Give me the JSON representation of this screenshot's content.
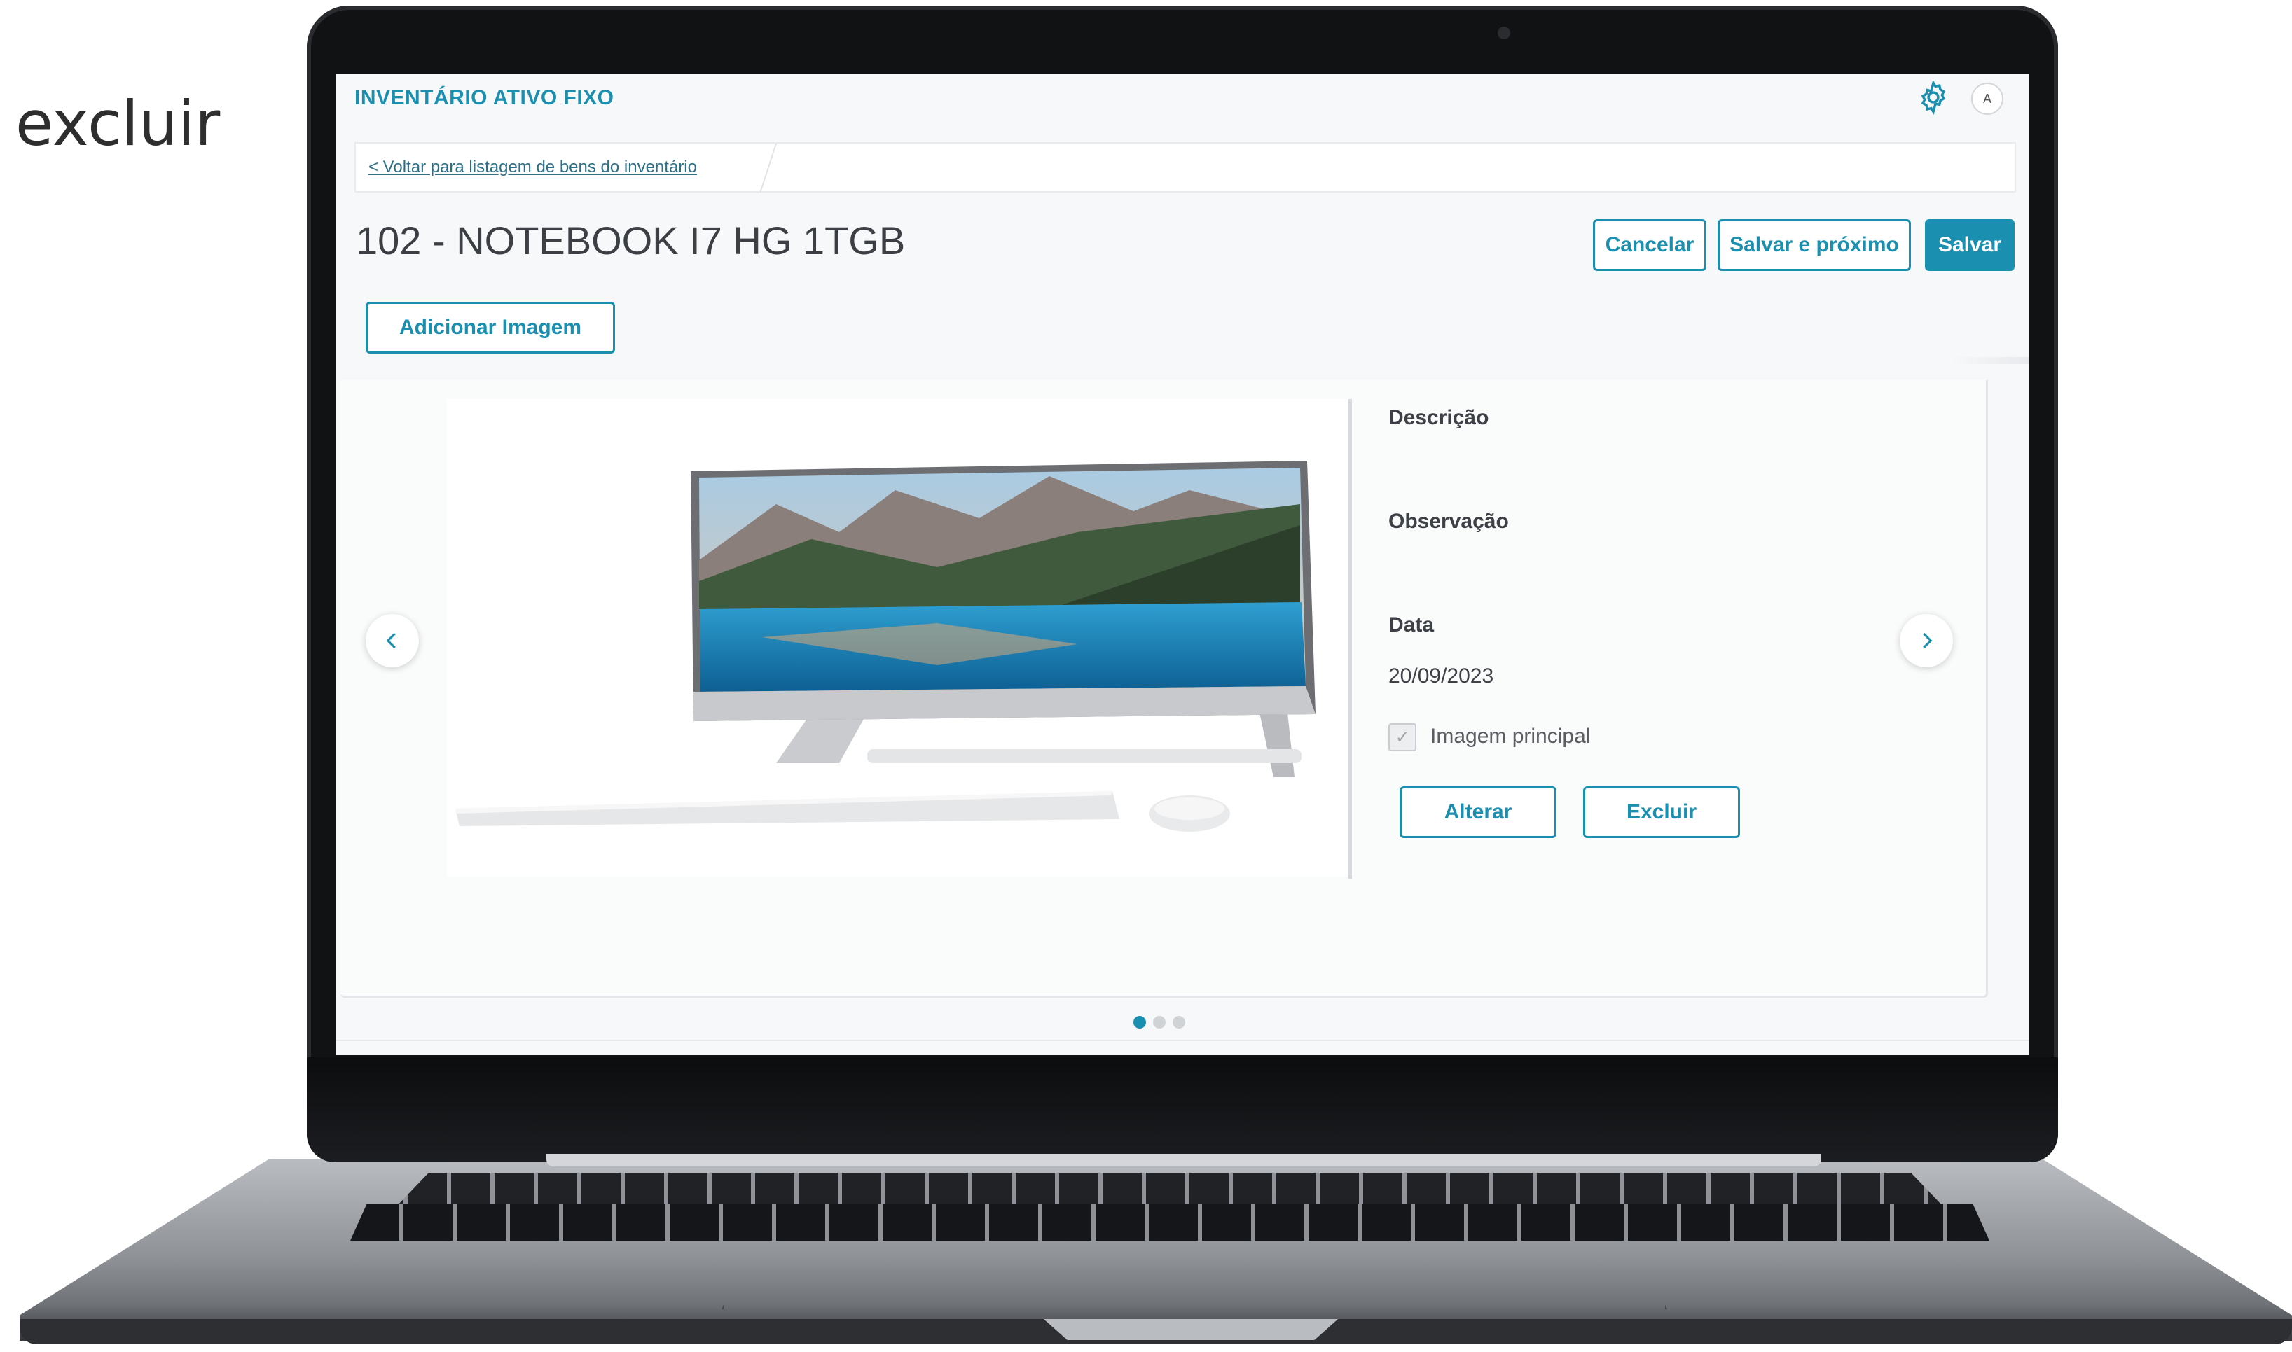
{
  "caption": "excluir",
  "app": {
    "title": "INVENTÁRIO ATIVO FIXO",
    "settings_icon": "gear-icon",
    "avatar_initial": "A"
  },
  "breadcrumb": {
    "back_link": "< Voltar para listagem de bens do inventário"
  },
  "page": {
    "title": "102 - NOTEBOOK I7 HG 1TGB"
  },
  "actions": {
    "cancel_label": "Cancelar",
    "save_next_label": "Salvar e próximo",
    "save_label": "Salvar",
    "add_image_label": "Adicionar Imagem"
  },
  "image_detail": {
    "description_label": "Descrição",
    "observation_label": "Observação",
    "date_label": "Data",
    "date_value": "20/09/2023",
    "main_image_label": "Imagem principal",
    "main_image_checked": true,
    "alter_label": "Alterar",
    "delete_label": "Excluir"
  },
  "carousel": {
    "prev_icon": "chevron-left-icon",
    "next_icon": "chevron-right-icon",
    "total_slides": 3,
    "active_slide": 1
  },
  "colors": {
    "accent": "#1b8fb0",
    "text": "#3d4046"
  }
}
